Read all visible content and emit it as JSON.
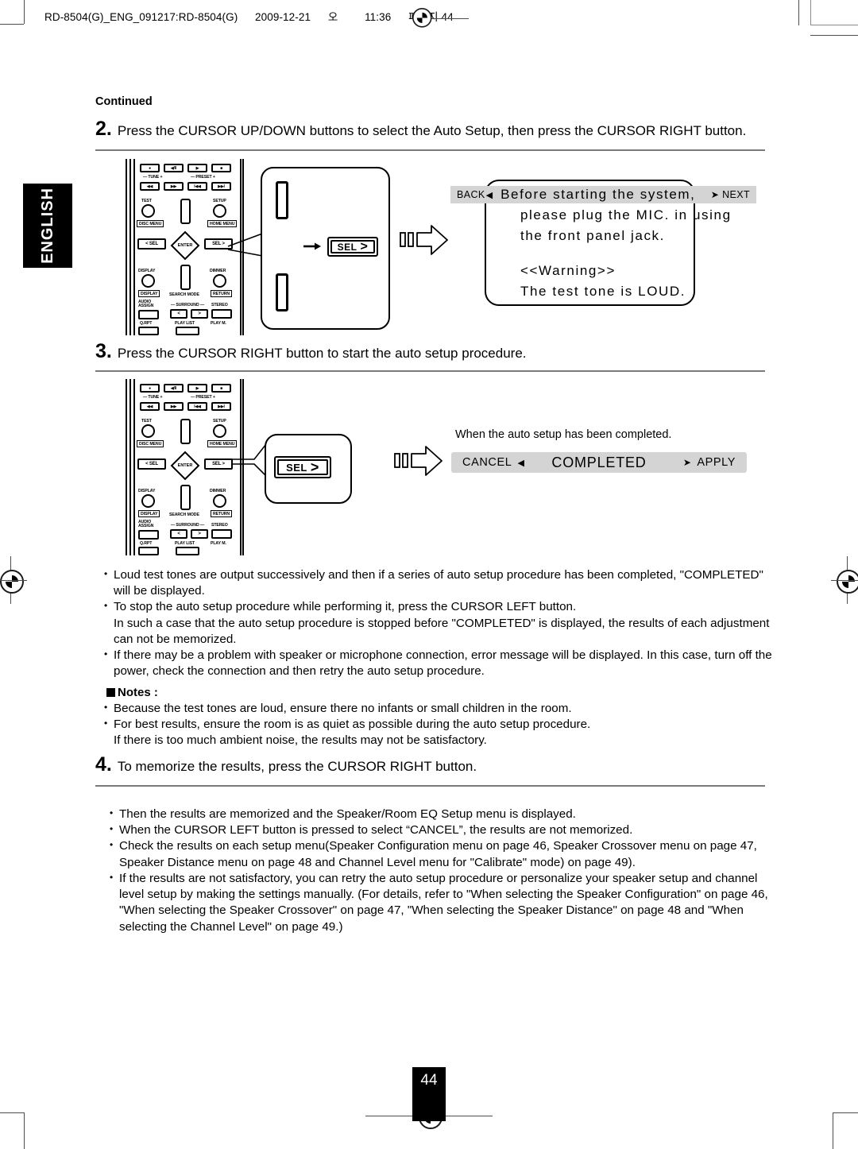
{
  "document": {
    "file_header": "RD-8504(G)_ENG_091217:RD-8504(G)   2009-12-21   오      11:36   페이지 44",
    "file_header_parts": {
      "filename": "RD-8504(G)_ENG_091217:RD-8504(G)",
      "date": "2009-12-21",
      "ampm": "오",
      "time": "11:36",
      "page_label": "페이지 44"
    },
    "language_tab": "ENGLISH",
    "continued_label": "Continued",
    "page_number": "44"
  },
  "steps": [
    {
      "number": "2.",
      "text": "Press the CURSOR UP/DOWN buttons to select the Auto Setup, then press the CURSOR RIGHT button."
    },
    {
      "number": "3.",
      "text": "Press the CURSOR RIGHT button to start the auto setup procedure."
    },
    {
      "number": "4.",
      "text": "To memorize the results, press the CURSOR RIGHT button."
    }
  ],
  "remote": {
    "transport_row": [
      "●",
      "◀/II",
      "▶",
      "■"
    ],
    "tune_label": "—  TUNE  +",
    "preset_label": "—  PRESET  +",
    "skip_row": [
      "◀◀",
      "▶▶",
      "I◀◀",
      "▶▶I"
    ],
    "test_label": "TEST",
    "setup_label": "SETUP",
    "disc_menu_label": "DISC MENU",
    "home_menu_label": "HOME MENU",
    "sel_left_label": "< SEL",
    "enter_label": "ENTER",
    "sel_right_label": "SEL >",
    "display_label": "DISPLAY",
    "dimmer_label": "DIMMER",
    "display_boxed_label": "DISPLAY",
    "return_label": "RETURN",
    "search_mode_label": "SEARCH MODE",
    "audio_assign_label": "AUDIO\nASSIGN",
    "surround_label": "—  SURROUND  —",
    "stereo_label": "STEREO",
    "surround_left": "<",
    "surround_right": ">",
    "qrpt_label": "Q.RPT",
    "play_list_label": "PLAY LIST",
    "play_m_label": "PLAY M."
  },
  "callouts": {
    "sel_key": {
      "text": "SEL",
      "chevron": "›"
    }
  },
  "osd_step2": {
    "back_label": "BACK",
    "back_arrow": "◀",
    "next_arrow": "➤",
    "next_label": "NEXT",
    "lines": [
      "Before starting the system,",
      "please plug the MIC. in using",
      "the front panel jack.",
      "",
      "<<Warning>>",
      "The test tone is LOUD."
    ]
  },
  "osd_step3": {
    "caption": "When the auto setup has been completed.",
    "cancel_label": "CANCEL",
    "cancel_arrow": "◀",
    "status_label": "COMPLETED",
    "apply_arrow": "➤",
    "apply_label": "APPLY"
  },
  "bullets_after_step3": [
    {
      "lines": [
        "Loud test tones are output successively and then if a series of auto setup procedure has been completed, \"COMPLETED\"",
        "will be displayed."
      ]
    },
    {
      "lines": [
        "To stop the auto setup procedure while performing it, press the CURSOR LEFT button.",
        "In such a case that the auto setup procedure is stopped before \"COMPLETED\" is displayed, the results of each adjustment",
        "can not be memorized."
      ]
    },
    {
      "lines": [
        "If there may be a problem with speaker or microphone connection, error message will be displayed. In this case, turn off the",
        "power, check the connection and then retry the auto setup procedure."
      ]
    }
  ],
  "notes": {
    "heading": "Notes :",
    "items": [
      {
        "lines": [
          "Because the test tones are loud, ensure there no infants or small children in the room."
        ]
      },
      {
        "lines": [
          "For best results, ensure the room is as quiet as possible during the auto setup procedure.",
          "If there is too much ambient noise, the results may not be satisfactory."
        ]
      }
    ]
  },
  "bullets_after_step4": [
    {
      "lines": [
        "Then the results are memorized and the Speaker/Room EQ Setup menu is displayed."
      ]
    },
    {
      "lines": [
        "When the CURSOR LEFT button is pressed to select “CANCEL”, the results are not memorized."
      ]
    },
    {
      "lines": [
        "Check the results on each setup menu(Speaker Configuration menu on page 46, Speaker Crossover menu on page 47,",
        "Speaker Distance menu on page 48 and Channel Level menu for \"Calibrate\" mode) on page 49)."
      ]
    },
    {
      "lines": [
        "If the results are not satisfactory, you can retry the auto setup procedure or personalize your speaker setup and channel",
        "level setup by making the settings manually. (For details, refer to \"When selecting the Speaker Configuration\" on page 46,",
        "\"When selecting the Speaker Crossover\" on page 47, \"When selecting the Speaker Distance\" on page 48 and \"When",
        "selecting the Channel Level\" on page 49.)"
      ]
    }
  ],
  "colors": {
    "osd_bar": "#d4d4d4",
    "rule": "#7a7a7a",
    "ink": "#000000"
  }
}
